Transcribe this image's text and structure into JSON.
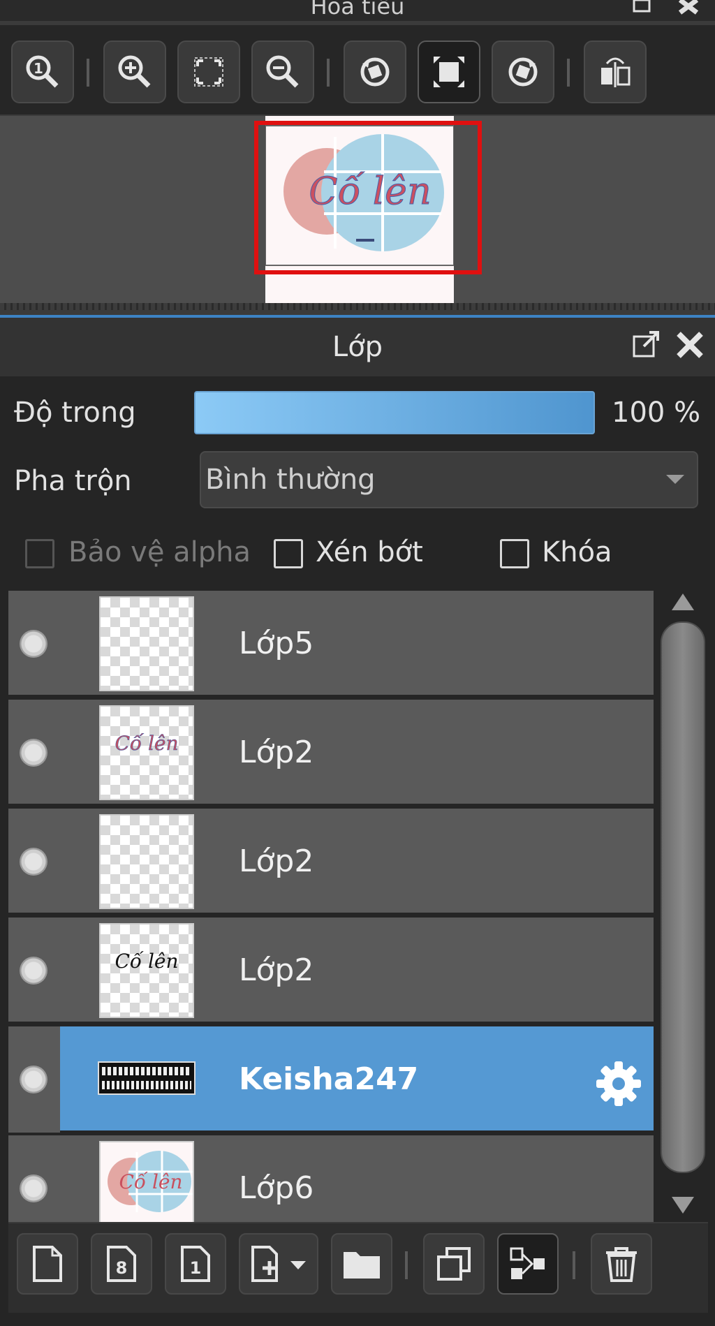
{
  "navigator": {
    "title": "Hoa tiêu",
    "toolbar": [
      "zoom-actual-icon",
      "zoom-in-icon",
      "fit-window-icon",
      "zoom-out-icon",
      "rotate-left-icon",
      "full-view-icon",
      "rotate-right-icon",
      "flip-horizontal-icon"
    ]
  },
  "layer_panel": {
    "title": "Lớp",
    "opacity_label": "Độ trong",
    "opacity_value": "100 %",
    "opacity_fraction": 1.0,
    "blend_label": "Pha trộn",
    "blend_value": "Bình thường",
    "protect_alpha_label": "Bảo vệ alpha",
    "clip_label": "Xén bớt",
    "lock_label": "Khóa",
    "layers": [
      {
        "name": "Lớp5",
        "selected": false
      },
      {
        "name": "Lớp2",
        "selected": false
      },
      {
        "name": "Lớp2",
        "selected": false
      },
      {
        "name": "Lớp2",
        "selected": false
      },
      {
        "name": "Keisha247",
        "selected": true
      },
      {
        "name": "Lớp6",
        "selected": false
      }
    ]
  },
  "artwork": {
    "text": "Cố lên"
  },
  "colors": {
    "selection_accent": "#5599d3",
    "opacity_start": "#8ccaf6",
    "opacity_end": "#4f95cf",
    "view_rect": "#e01010"
  }
}
